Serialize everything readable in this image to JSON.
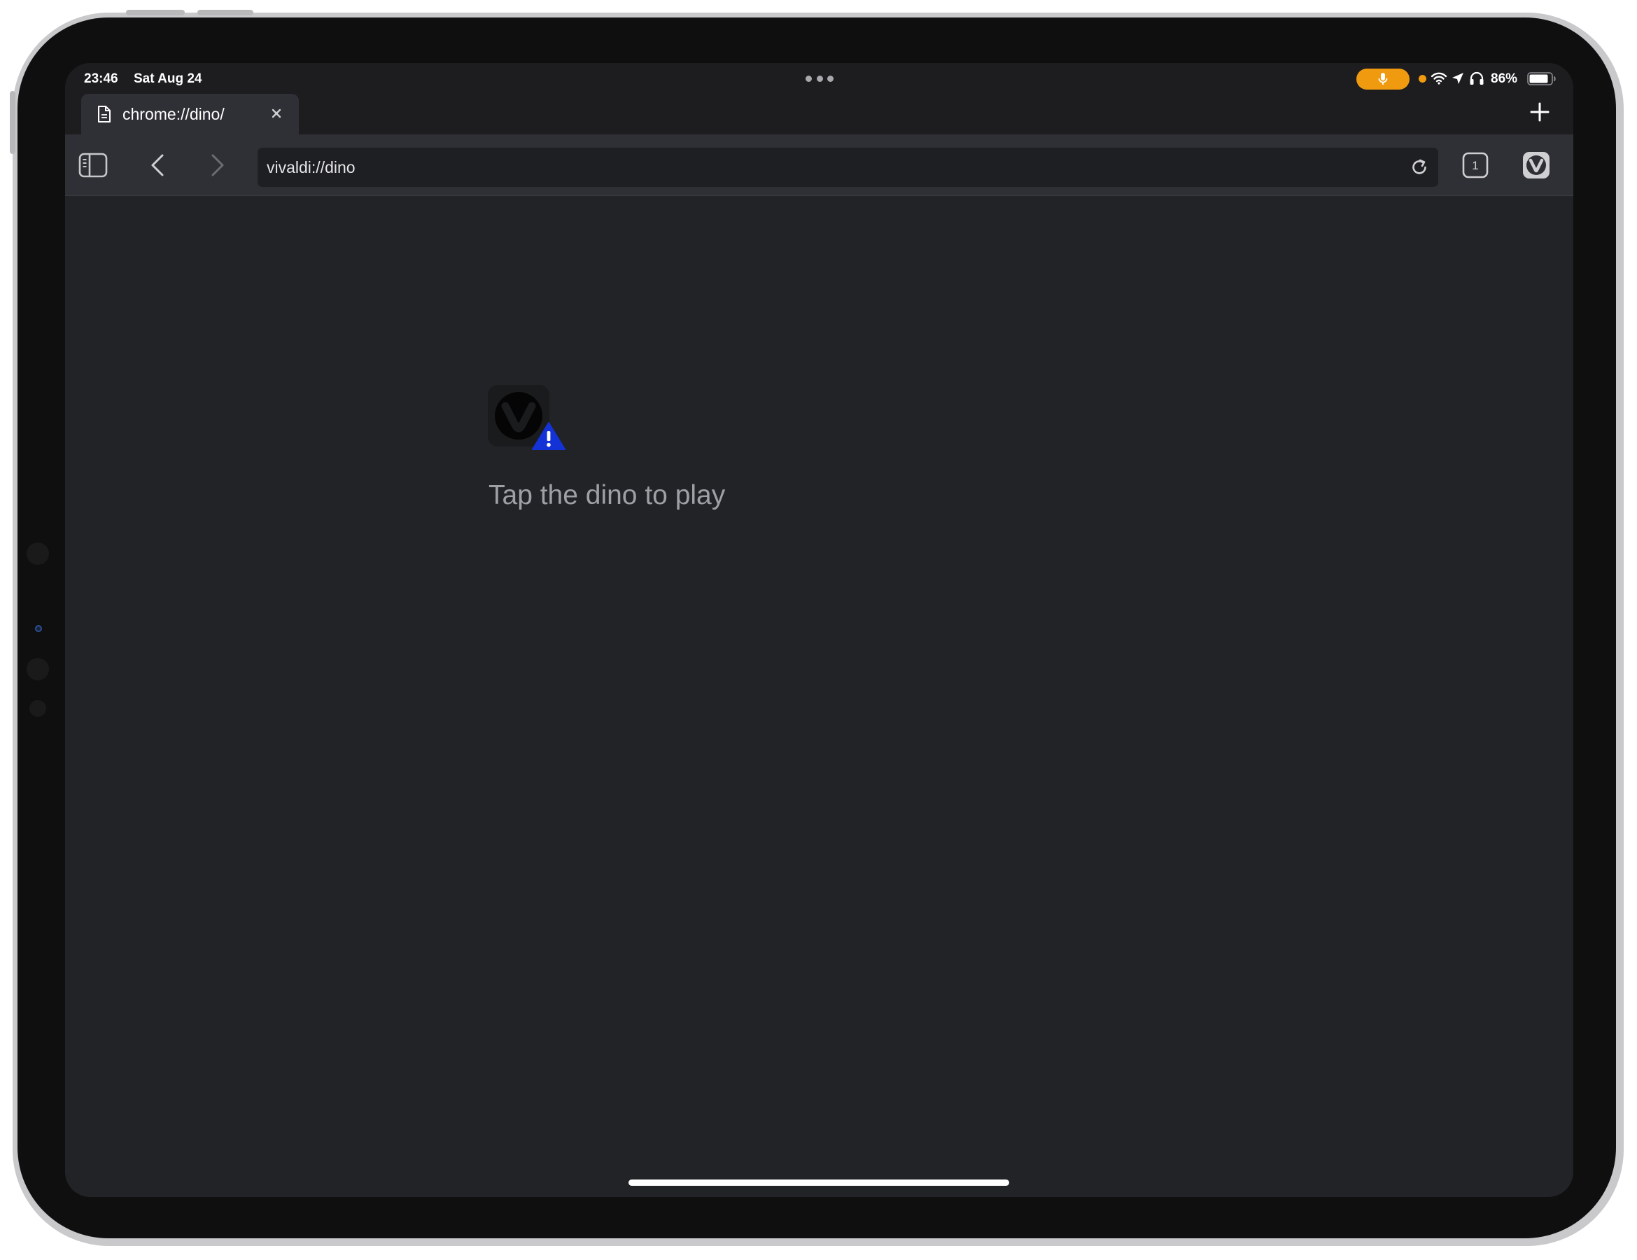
{
  "status_bar": {
    "time": "23:46",
    "date": "Sat Aug 24",
    "battery_percent": "86%",
    "battery_level": 0.86,
    "mic_indicator_color": "#f09a10",
    "icons": [
      "mic-icon",
      "wifi-icon",
      "location-icon",
      "headphones-icon",
      "battery-icon"
    ]
  },
  "tab_strip": {
    "tabs": [
      {
        "title": "chrome://dino/",
        "icon": "document-icon",
        "active": true
      }
    ],
    "close_icon": "close-icon",
    "new_tab_icon": "plus-icon"
  },
  "toolbar": {
    "panel_icon": "panel-toggle-icon",
    "back_icon": "chevron-left-icon",
    "forward_icon": "chevron-right-icon",
    "address": "vivaldi://dino",
    "reload_icon": "reload-icon",
    "tab_count": "1",
    "menu_icon": "vivaldi-menu-icon"
  },
  "content": {
    "error_icon": "vivaldi-logo-warning-icon",
    "message": "Tap the dino to play"
  },
  "colors": {
    "background": "#222327",
    "toolbar": "#2f3035",
    "warning_badge": "#1433d6"
  }
}
